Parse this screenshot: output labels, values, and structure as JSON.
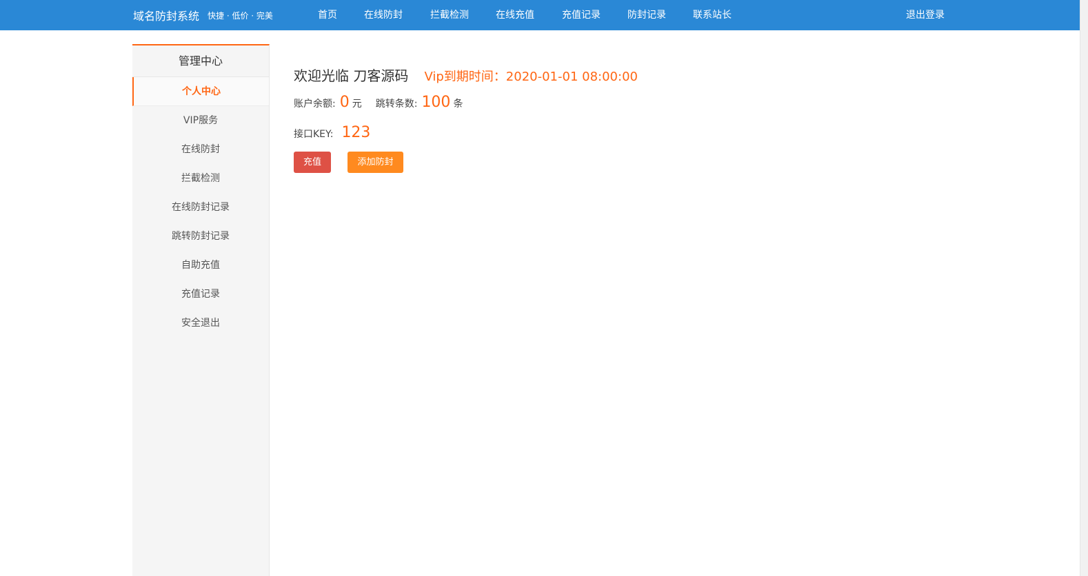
{
  "colors": {
    "brand": "#2a88d6",
    "accent": "#ff6613",
    "danger": "#de5145",
    "warn": "#ff8a1f"
  },
  "header": {
    "title": "域名防封系统",
    "slogan": "快捷 · 低价 · 完美",
    "nav": [
      "首页",
      "在线防封",
      "拦截检测",
      "在线充值",
      "充值记录",
      "防封记录",
      "联系站长"
    ],
    "logout": "退出登录"
  },
  "sidebar": {
    "heading": "管理中心",
    "items": [
      {
        "label": "个人中心",
        "active": true
      },
      {
        "label": "VIP服务",
        "active": false
      },
      {
        "label": "在线防封",
        "active": false
      },
      {
        "label": "拦截检测",
        "active": false
      },
      {
        "label": "在线防封记录",
        "active": false
      },
      {
        "label": "跳转防封记录",
        "active": false
      },
      {
        "label": "自助充值",
        "active": false
      },
      {
        "label": "充值记录",
        "active": false
      },
      {
        "label": "安全退出",
        "active": false
      }
    ]
  },
  "main": {
    "welcome": "欢迎光临 刀客源码",
    "vip_expiry": "Vip到期时间：2020-01-01 08:00:00",
    "balance_label": "账户余额:",
    "balance_value": "0",
    "balance_unit": "元",
    "jump_label": "跳转条数:",
    "jump_value": "100",
    "jump_unit": "条",
    "key_label": "接口KEY:",
    "key_value": "123",
    "recharge_button": "充值",
    "add_button": "添加防封"
  }
}
